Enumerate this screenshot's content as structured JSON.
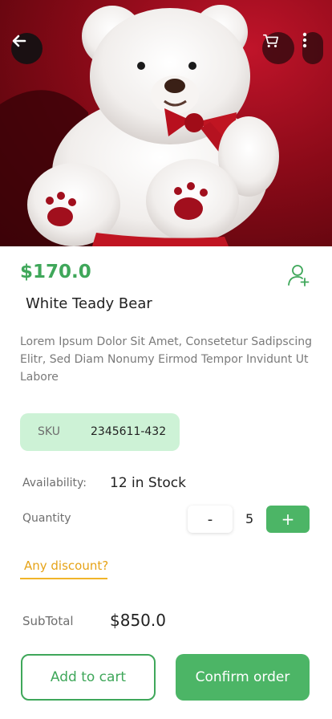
{
  "product": {
    "image_name": "white-teddy-bear-photo",
    "price": "$170.0",
    "title": "White Teady Bear",
    "description": "Lorem Ipsum Dolor Sit Amet, Consetetur Sadipscing Elitr, Sed Diam Nonumy Eirmod Tempor Invidunt Ut Labore"
  },
  "sku": {
    "label": "SKU",
    "value": "2345611-432"
  },
  "availability": {
    "label": "Availability:",
    "value": "12 in Stock"
  },
  "quantity": {
    "label": "Quantity",
    "minus": "-",
    "value": "5",
    "plus": "+"
  },
  "discount": {
    "label": "Any discount?"
  },
  "subtotal": {
    "label": "SubTotal",
    "value": "$850.0"
  },
  "actions": {
    "add_to_cart": "Add to cart",
    "confirm": "Confirm order"
  },
  "icons": {
    "back": "arrow-left-icon",
    "cart": "cart-icon",
    "more": "more-vertical-icon",
    "follow": "user-plus-icon"
  },
  "colors": {
    "accent": "#4cb566",
    "price": "#3fa75a",
    "sku_bg": "#cdf2d6",
    "discount": "#f0b429",
    "hero_bg": "#8a0a18"
  }
}
